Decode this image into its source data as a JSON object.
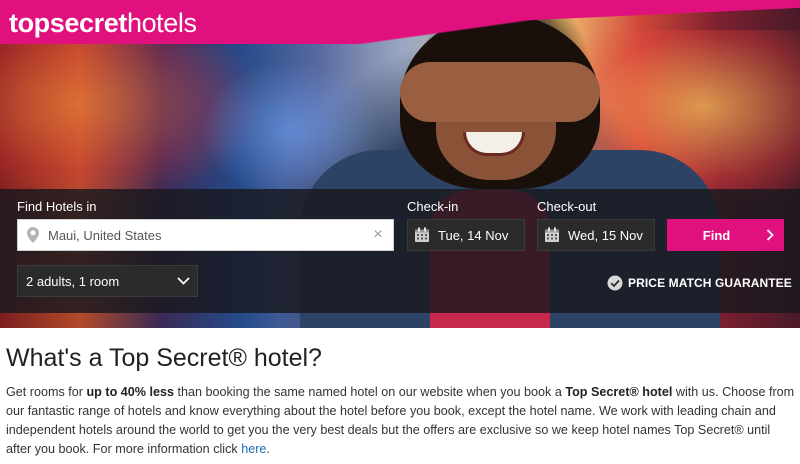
{
  "header": {
    "logo_bold": "topsecret",
    "logo_light": "hotels",
    "brand_color": "#e0117f"
  },
  "search": {
    "destination_label": "Find Hotels in",
    "destination_value": "Maui, United States",
    "clear_icon": "close-icon",
    "checkin_label": "Check-in",
    "checkin_value": "Tue, 14 Nov",
    "checkout_label": "Check-out",
    "checkout_value": "Wed, 15 Nov",
    "find_label": "Find",
    "guests_value": "2 adults, 1 room",
    "guarantee_label": "PRICE MATCH GUARANTEE"
  },
  "content": {
    "title": "What's a Top Secret® hotel?",
    "p1": "Get rooms for ",
    "p2": "up to 40% less",
    "p3": " than booking the same named hotel on our website when you book a ",
    "p4": "Top Secret® hotel",
    "p5": " with us. Choose from our fantastic range of hotels and know everything about the hotel before you book, except the hotel name. We work with leading chain and independent hotels around the world to get you the very best deals but the offers are exclusive so we keep hotel names Top Secret® until after you book. For more information click ",
    "link": "here",
    "p6": ".",
    "link_color": "#1a6bb8"
  }
}
